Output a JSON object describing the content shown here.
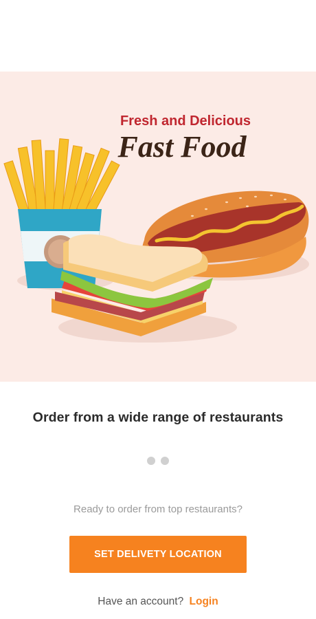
{
  "hero": {
    "tagline": "Fresh and Delicious",
    "title": "Fast Food",
    "colors": {
      "background": "#fcebe6",
      "tagline": "#c0262f",
      "title": "#3b2417"
    }
  },
  "onboarding": {
    "headline": "Order from a wide range of restaurants",
    "page_indicator": {
      "total": 2,
      "active": 1
    }
  },
  "footer": {
    "prompt": "Ready to order from top restaurants?",
    "cta_label": "SET DELIVETY LOCATION",
    "account_text": "Have an account?",
    "login_label": "Login"
  },
  "theme": {
    "accent": "#f6821f"
  }
}
